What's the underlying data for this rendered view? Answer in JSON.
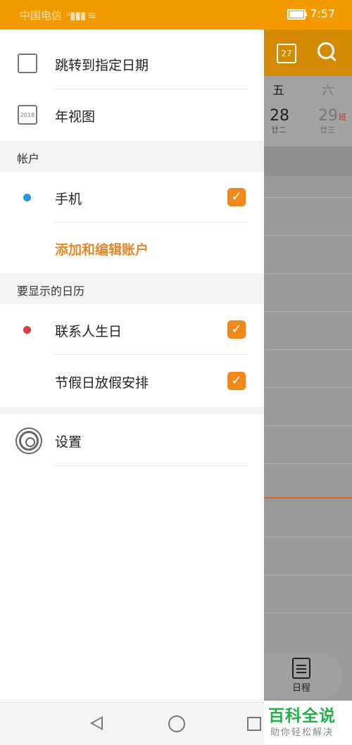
{
  "status": {
    "carrier": "中国电信",
    "network": "4G",
    "time": "7:57"
  },
  "calendar": {
    "header_icon_text": "27",
    "weekdays": [
      "五",
      "六"
    ],
    "days": [
      {
        "num": "28",
        "lunar": "廿二"
      },
      {
        "num": "29",
        "lunar": "廿三",
        "badge": "班"
      }
    ],
    "schedule_label": "日程"
  },
  "drawer": {
    "jump_label": "跳转到指定日期",
    "year_label": "年视图",
    "year_icon_text": "2018",
    "accounts_section": "帐户",
    "phone_label": "手机",
    "add_account_label": "添加和编辑账户",
    "calendars_section": "要显示的日历",
    "birthday_label": "联系人生日",
    "holiday_label": "节假日放假安排",
    "settings_label": "设置",
    "colors": {
      "phone_dot": "#1a9ee0",
      "birthday_dot": "#e23b3b",
      "accent": "#f0891a"
    }
  },
  "watermark": {
    "title": "百科全说",
    "subtitle": "助你轻松解决"
  }
}
